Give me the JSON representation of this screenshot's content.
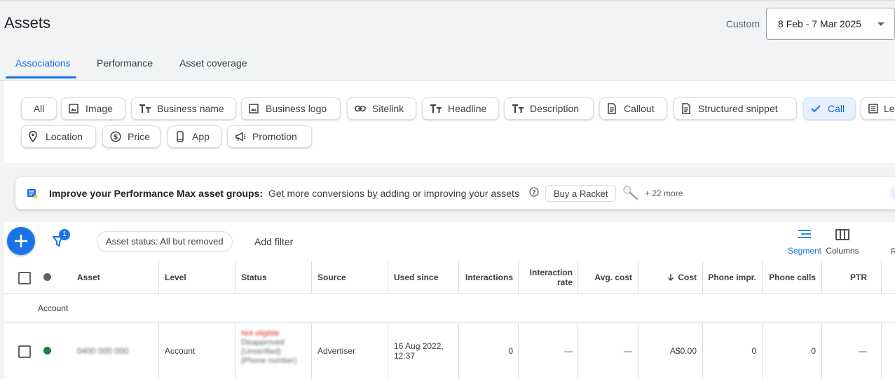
{
  "page": {
    "title": "Assets"
  },
  "date_range": {
    "prefix": "Custom",
    "value": "8 Feb - 7 Mar 2025"
  },
  "tabs": [
    {
      "label": "Associations",
      "active": true
    },
    {
      "label": "Performance",
      "active": false
    },
    {
      "label": "Asset coverage",
      "active": false
    }
  ],
  "chips": {
    "all": "All",
    "image": "Image",
    "business_name": "Business name",
    "business_logo": "Business logo",
    "sitelink": "Sitelink",
    "headline": "Headline",
    "description": "Description",
    "callout": "Callout",
    "structured_snippet": "Structured snippet",
    "call": "Call",
    "lead_form_partial": "Le",
    "location": "Location",
    "price": "Price",
    "app": "App",
    "promotion": "Promotion",
    "selected": "Call"
  },
  "banner": {
    "title": "Improve your Performance Max asset groups:",
    "text": "Get more conversions by adding or improving your assets",
    "button": "Buy a Racket",
    "more": "+ 22 more"
  },
  "toolbar": {
    "filter_count": "1",
    "status_filter": "Asset status: All but removed",
    "add_filter": "Add filter",
    "segment": "Segment",
    "columns": "Columns",
    "cut_label": "R"
  },
  "table": {
    "headers": {
      "asset": "Asset",
      "level": "Level",
      "status": "Status",
      "source": "Source",
      "used_since": "Used since",
      "interactions": "Interactions",
      "interaction_rate": "Interaction rate",
      "avg_cost": "Avg. cost",
      "cost": "Cost",
      "phone_impr": "Phone impr.",
      "phone_calls": "Phone calls",
      "ptr": "PTR"
    },
    "group_label": "Account",
    "rows": [
      {
        "asset": "0400 000 000",
        "level": "Account",
        "status_line1": "Not eligible",
        "status_line2": "Disapproved",
        "status_line3": "(Unverified)",
        "status_line4": "(Phone number)",
        "source": "Advertiser",
        "used_since": "16 Aug 2022, 12:37",
        "interactions": "0",
        "interaction_rate": "—",
        "avg_cost": "—",
        "cost": "A$0.00",
        "phone_impr": "0",
        "phone_calls": "0",
        "ptr": "—"
      }
    ]
  },
  "colors": {
    "accent": "#1a73e8",
    "enabled_dot": "#188038",
    "error": "#d93025"
  }
}
